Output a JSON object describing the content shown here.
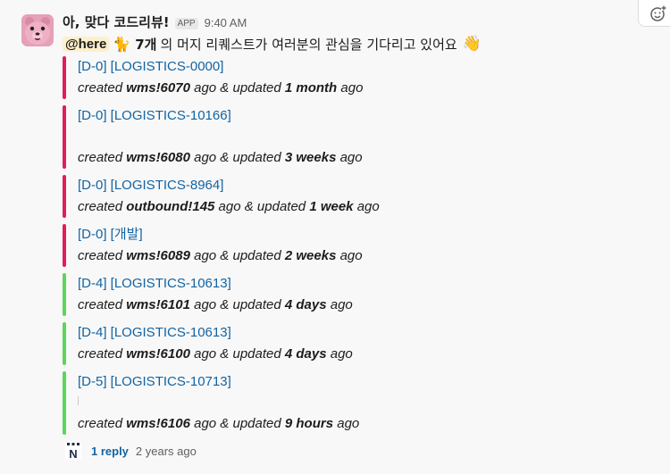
{
  "header": {
    "bot_name": "아, 맞다 코드리뷰!",
    "app_badge": "APP",
    "time": "9:40 AM"
  },
  "intro": {
    "mention": "@here",
    "cat_emoji": "🐈",
    "count": "7개",
    "text": "의 머지 리퀘스트가 여러분의 관심을 기다리고 있어요",
    "wave_emoji": "👋"
  },
  "items": [
    {
      "title": "[D-0] [LOGISTICS-0000]",
      "created_word": "created",
      "ref": "wms!6070",
      "mid": "ago & updated",
      "updated": "1 month",
      "tail": "ago",
      "color": "#e01e5a",
      "blank_line": false
    },
    {
      "title": "[D-0] [LOGISTICS-10166]",
      "created_word": "created",
      "ref": "wms!6080",
      "mid": "ago & updated",
      "updated": "3 weeks",
      "tail": "ago",
      "color": "#e01e5a",
      "blank_line": true
    },
    {
      "title": "[D-0] [LOGISTICS-8964]",
      "created_word": "created",
      "ref": "outbound!145",
      "mid": "ago & updated",
      "updated": "1 week",
      "tail": "ago",
      "color": "#e01e5a",
      "blank_line": false
    },
    {
      "title": "[D-0] [개발]",
      "created_word": "created",
      "ref": "wms!6089",
      "mid": "ago & updated",
      "updated": "2 weeks",
      "tail": "ago",
      "color": "#e01e5a",
      "blank_line": false
    },
    {
      "title": "[D-4] [LOGISTICS-10613]",
      "created_word": "created",
      "ref": "wms!6101",
      "mid": "ago & updated",
      "updated": "4 days",
      "tail": "ago",
      "color": "#5bd65b",
      "blank_line": false
    },
    {
      "title": "[D-4] [LOGISTICS-10613]",
      "created_word": "created",
      "ref": "wms!6100",
      "mid": "ago & updated",
      "updated": "4 days",
      "tail": "ago",
      "color": "#5bd65b",
      "blank_line": false
    },
    {
      "title": "[D-5] [LOGISTICS-10713]",
      "created_word": "created",
      "ref": "wms!6106",
      "mid": "ago & updated",
      "updated": "9 hours",
      "tail": "ago",
      "color": "#5bd65b",
      "blank_line": true
    }
  ],
  "thread": {
    "avatar_letter": "N",
    "reply_label": "1 reply",
    "reply_time": "2 years ago"
  },
  "icons": {
    "reaction": "add-reaction-icon",
    "avatar": "bot-avatar-icon"
  }
}
